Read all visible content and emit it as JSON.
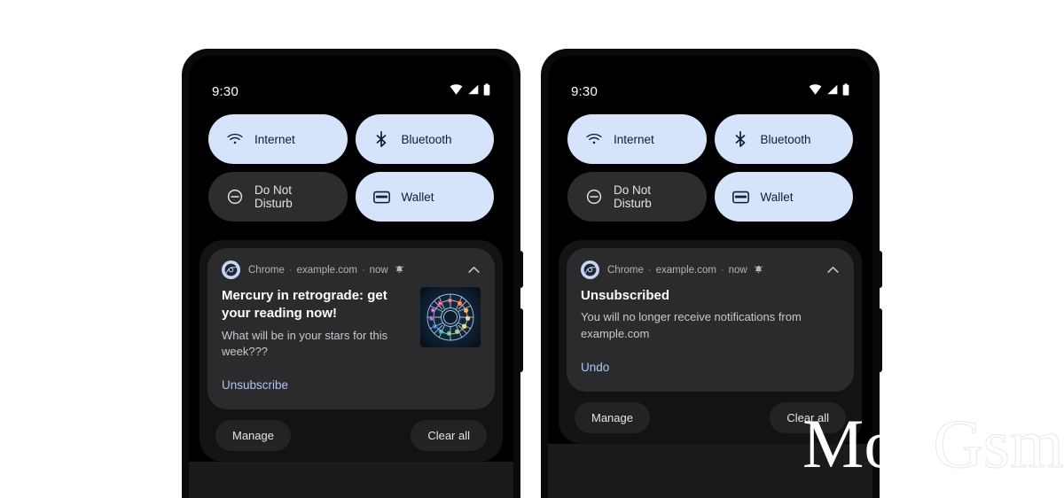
{
  "page": {
    "background": "#ffffff",
    "watermark": {
      "solid": "Mob",
      "outline": "Gsm"
    }
  },
  "phones": [
    {
      "id": "phone-left",
      "status_bar": {
        "clock": "9:30",
        "icons": [
          "wifi-icon",
          "cellular-signal-icon",
          "battery-icon"
        ]
      },
      "quick_settings": [
        {
          "label": "Internet",
          "icon": "wifi-icon",
          "state": "on",
          "colors": {
            "bg": "#d5e3fb",
            "fg": "#0c1f33"
          }
        },
        {
          "label": "Bluetooth",
          "icon": "bluetooth-icon",
          "state": "on",
          "colors": {
            "bg": "#d5e3fb",
            "fg": "#0c1f33"
          }
        },
        {
          "label": "Do Not Disturb",
          "icon": "dnd-icon",
          "state": "off",
          "colors": {
            "bg": "#2d2d30",
            "fg": "#e3e3e6"
          }
        },
        {
          "label": "Wallet",
          "icon": "wallet-icon",
          "state": "on",
          "colors": {
            "bg": "#d5e3fb",
            "fg": "#0c1f33"
          }
        }
      ],
      "notification": {
        "app_icon": "chrome-icon",
        "app_name": "Chrome",
        "source": "example.com",
        "time": "now",
        "alert_icon": "bell-icon",
        "separator": "·",
        "collapse_icon": "chevron-up-icon",
        "title": "Mercury in retrograde: get your reading now!",
        "body": "What will be in your stars for this week???",
        "action_label": "Unsubscribe",
        "action_color": "#aec6f0",
        "thumbnail": "zodiac-wheel-image",
        "has_thumbnail": true
      },
      "footer": {
        "manage_label": "Manage",
        "clear_all_label": "Clear all"
      }
    },
    {
      "id": "phone-right",
      "status_bar": {
        "clock": "9:30",
        "icons": [
          "wifi-icon",
          "cellular-signal-icon",
          "battery-icon"
        ]
      },
      "quick_settings": [
        {
          "label": "Internet",
          "icon": "wifi-icon",
          "state": "on",
          "colors": {
            "bg": "#d5e3fb",
            "fg": "#0c1f33"
          }
        },
        {
          "label": "Bluetooth",
          "icon": "bluetooth-icon",
          "state": "on",
          "colors": {
            "bg": "#d5e3fb",
            "fg": "#0c1f33"
          }
        },
        {
          "label": "Do Not Disturb",
          "icon": "dnd-icon",
          "state": "off",
          "colors": {
            "bg": "#2d2d30",
            "fg": "#e3e3e6"
          }
        },
        {
          "label": "Wallet",
          "icon": "wallet-icon",
          "state": "on",
          "colors": {
            "bg": "#d5e3fb",
            "fg": "#0c1f33"
          }
        }
      ],
      "notification": {
        "app_icon": "chrome-icon",
        "app_name": "Chrome",
        "source": "example.com",
        "time": "now",
        "alert_icon": "bell-icon",
        "separator": "·",
        "collapse_icon": "chevron-up-icon",
        "title": "Unsubscribed",
        "body": "You will no longer receive notifications from example.com",
        "action_label": "Undo",
        "action_color": "#aec6f0",
        "thumbnail": null,
        "has_thumbnail": false
      },
      "footer": {
        "manage_label": "Manage",
        "clear_all_label": "Clear all"
      }
    }
  ]
}
